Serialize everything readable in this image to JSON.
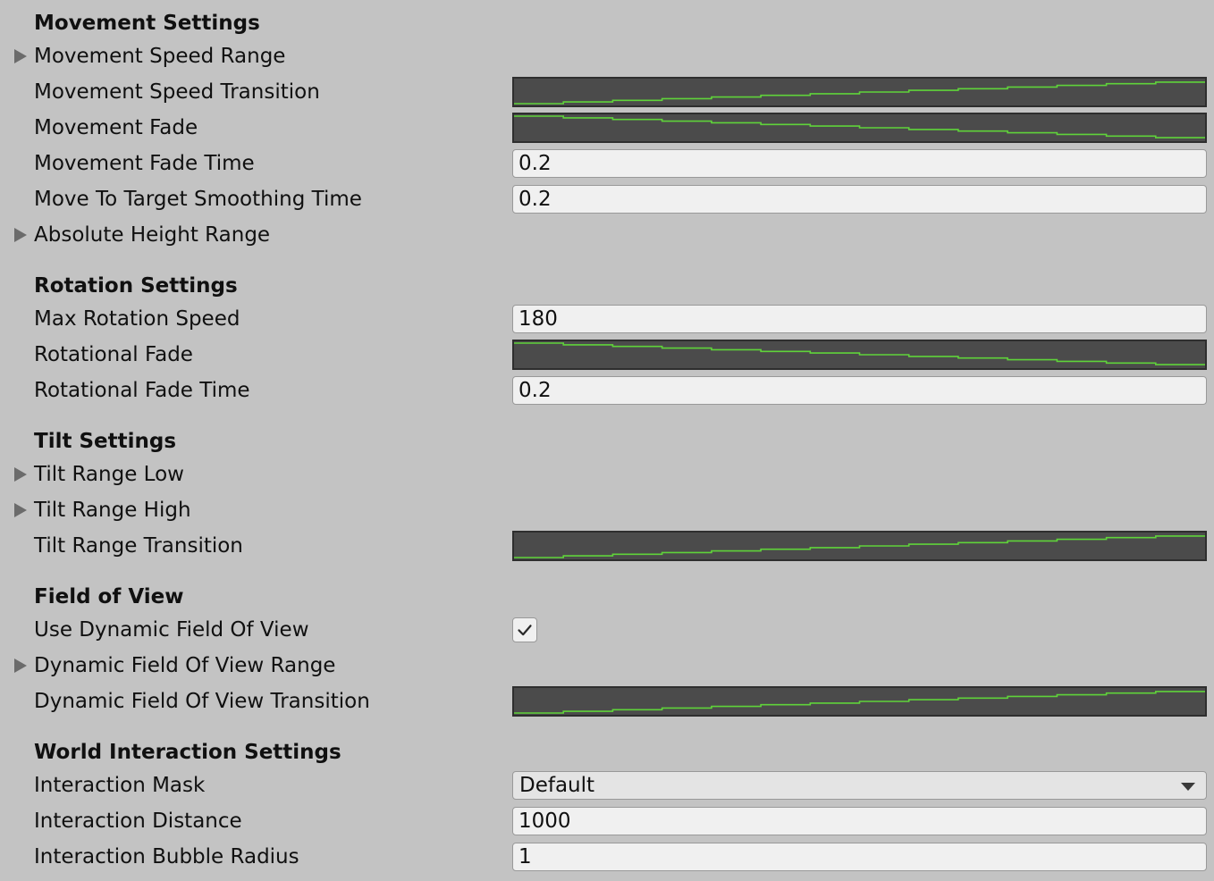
{
  "movement": {
    "header": "Movement Settings",
    "speed_range_label": "Movement Speed Range",
    "speed_transition_label": "Movement Speed Transition",
    "fade_label": "Movement Fade",
    "fade_time_label": "Movement Fade Time",
    "fade_time_value": "0.2",
    "smoothing_label": "Move To Target Smoothing Time",
    "smoothing_value": "0.2",
    "height_range_label": "Absolute Height Range"
  },
  "rotation": {
    "header": "Rotation Settings",
    "max_speed_label": "Max Rotation Speed",
    "max_speed_value": "180",
    "fade_label": "Rotational Fade",
    "fade_time_label": "Rotational Fade Time",
    "fade_time_value": "0.2"
  },
  "tilt": {
    "header": "Tilt Settings",
    "range_low_label": "Tilt Range Low",
    "range_high_label": "Tilt Range High",
    "transition_label": "Tilt Range Transition"
  },
  "fov": {
    "header": "Field of View",
    "use_dynamic_label": "Use Dynamic Field Of View",
    "use_dynamic_checked": true,
    "range_label": "Dynamic Field Of View Range",
    "transition_label": "Dynamic Field Of View Transition"
  },
  "world": {
    "header": "World Interaction Settings",
    "mask_label": "Interaction Mask",
    "mask_value": "Default",
    "distance_label": "Interaction Distance",
    "distance_value": "1000",
    "bubble_label": "Interaction Bubble Radius",
    "bubble_value": "1"
  },
  "colors": {
    "background": "#c3c3c3",
    "field_bg": "#f0f0f0",
    "curve_bg": "#4b4b4b",
    "curve_line": "#5fd33a"
  },
  "curves": {
    "rising": {
      "shape": "linear-increasing",
      "points": [
        [
          0,
          0
        ],
        [
          1,
          1
        ]
      ]
    },
    "falling": {
      "shape": "linear-decreasing",
      "points": [
        [
          0,
          1
        ],
        [
          1,
          0
        ]
      ]
    }
  }
}
